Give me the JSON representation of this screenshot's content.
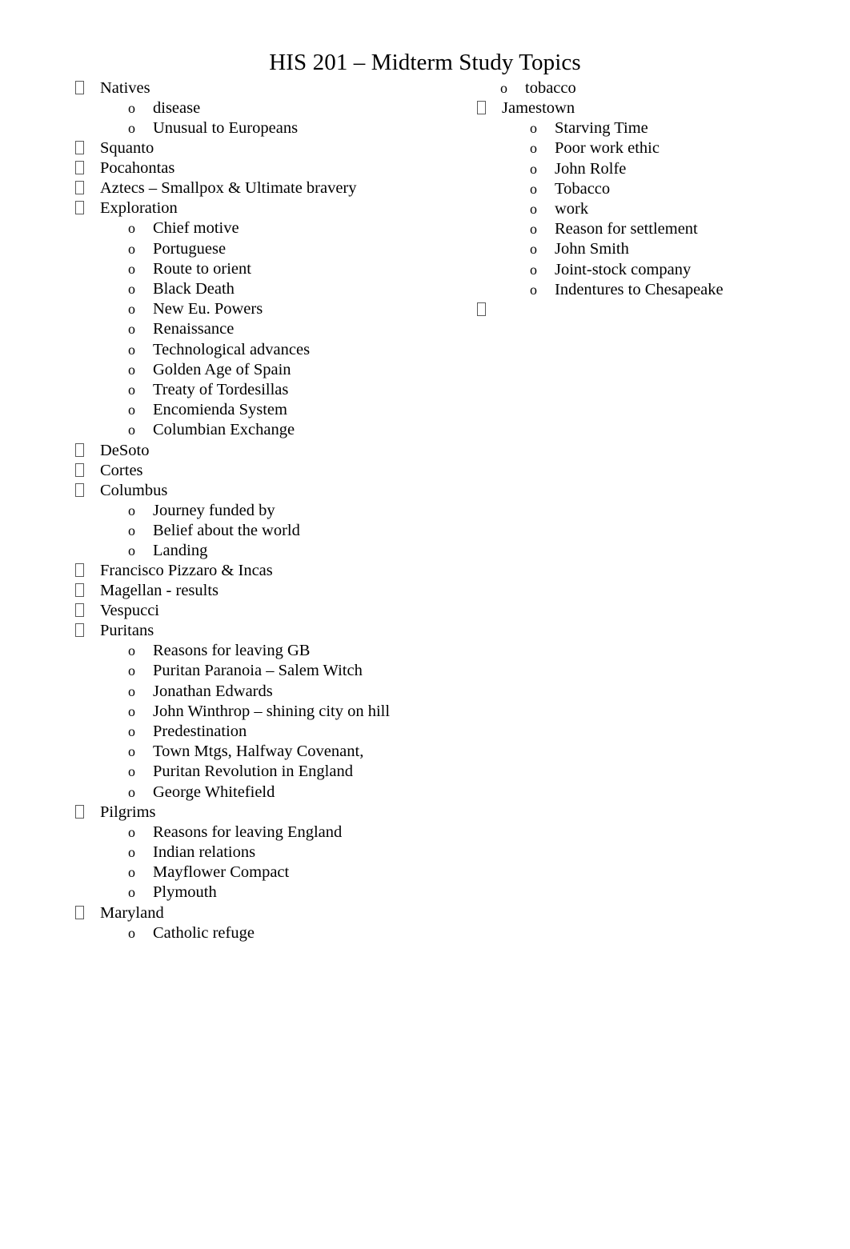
{
  "document": {
    "title": "HIS 201 – Midterm Study Topics",
    "bullet_glyph_level1": "missing-glyph-box",
    "bullet_glyph_level2": "o",
    "background_color": "#ffffff",
    "text_color": "#000000",
    "bullet_color": "#5a5a5a"
  },
  "left_column": [
    {
      "label": "Natives",
      "children": [
        "disease",
        "Unusual to Europeans"
      ]
    },
    {
      "label": "Squanto",
      "children": []
    },
    {
      "label": "Pocahontas",
      "children": []
    },
    {
      "label": "Aztecs – Smallpox & Ultimate bravery",
      "children": []
    },
    {
      "label": "Exploration",
      "children": [
        "Chief motive",
        "Portuguese",
        "Route to orient",
        "Black Death",
        "New Eu. Powers",
        "Renaissance",
        "Technological advances",
        "Golden Age of Spain",
        "Treaty of Tordesillas",
        "Encomienda System",
        "Columbian Exchange"
      ]
    },
    {
      "label": "DeSoto",
      "children": []
    },
    {
      "label": "Cortes",
      "children": []
    },
    {
      "label": "Columbus",
      "children": [
        "Journey funded by",
        "Belief about the world",
        "Landing"
      ]
    },
    {
      "label": "Francisco Pizzaro & Incas",
      "children": []
    },
    {
      "label": "Magellan - results",
      "children": []
    },
    {
      "label": "Vespucci",
      "children": []
    },
    {
      "label": "Puritans",
      "children": [
        "Reasons for leaving GB",
        "Puritan Paranoia – Salem Witch",
        "Jonathan Edwards",
        "John Winthrop – shining city on hill",
        "Predestination",
        "Town Mtgs, Halfway Covenant,",
        "Puritan Revolution in England",
        "George Whitefield"
      ]
    },
    {
      "label": "Pilgrims",
      "children": [
        "Reasons for leaving England",
        "Indian relations",
        "Mayflower Compact",
        "Plymouth"
      ]
    },
    {
      "label": "Maryland",
      "children": [
        "Catholic refuge"
      ]
    }
  ],
  "right_column": {
    "continued_children": [
      "tobacco"
    ],
    "items": [
      {
        "label": "Jamestown",
        "children": [
          "Starving Time",
          "Poor work ethic",
          "John Rolfe",
          "Tobacco",
          "work",
          "Reason for settlement",
          "John Smith",
          "Joint-stock company",
          "Indentures to Chesapeake"
        ]
      },
      {
        "label": "",
        "children": []
      }
    ]
  }
}
